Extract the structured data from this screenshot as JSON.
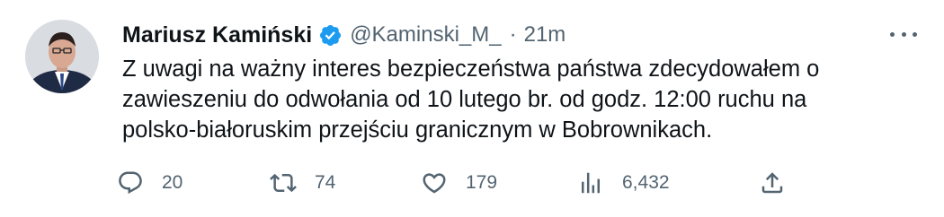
{
  "tweet": {
    "author_name": "Mariusz Kamiński",
    "handle": "@Kaminski_M_",
    "separator": "·",
    "time": "21m",
    "verified": true,
    "text_lines": [
      "Z uwagi na ważny interes bezpieczeństwa państwa zdecydowałem o",
      "zawieszeniu do odwołania od 10 lutego br. od godz. 12:00 ruchu na",
      "polsko-białoruskim przejściu granicznym w Bobrownikach."
    ],
    "replies": "20",
    "retweets": "74",
    "likes": "179",
    "views": "6,432"
  },
  "icons": {
    "more": "more-dots-icon",
    "verified": "verified-badge-icon",
    "reply": "reply-icon",
    "retweet": "retweet-icon",
    "like": "heart-icon",
    "views": "views-chart-icon",
    "share": "share-icon"
  },
  "colors": {
    "verified_blue": "#1d9bf0",
    "text_primary": "#0f1419",
    "text_secondary": "#536471"
  }
}
